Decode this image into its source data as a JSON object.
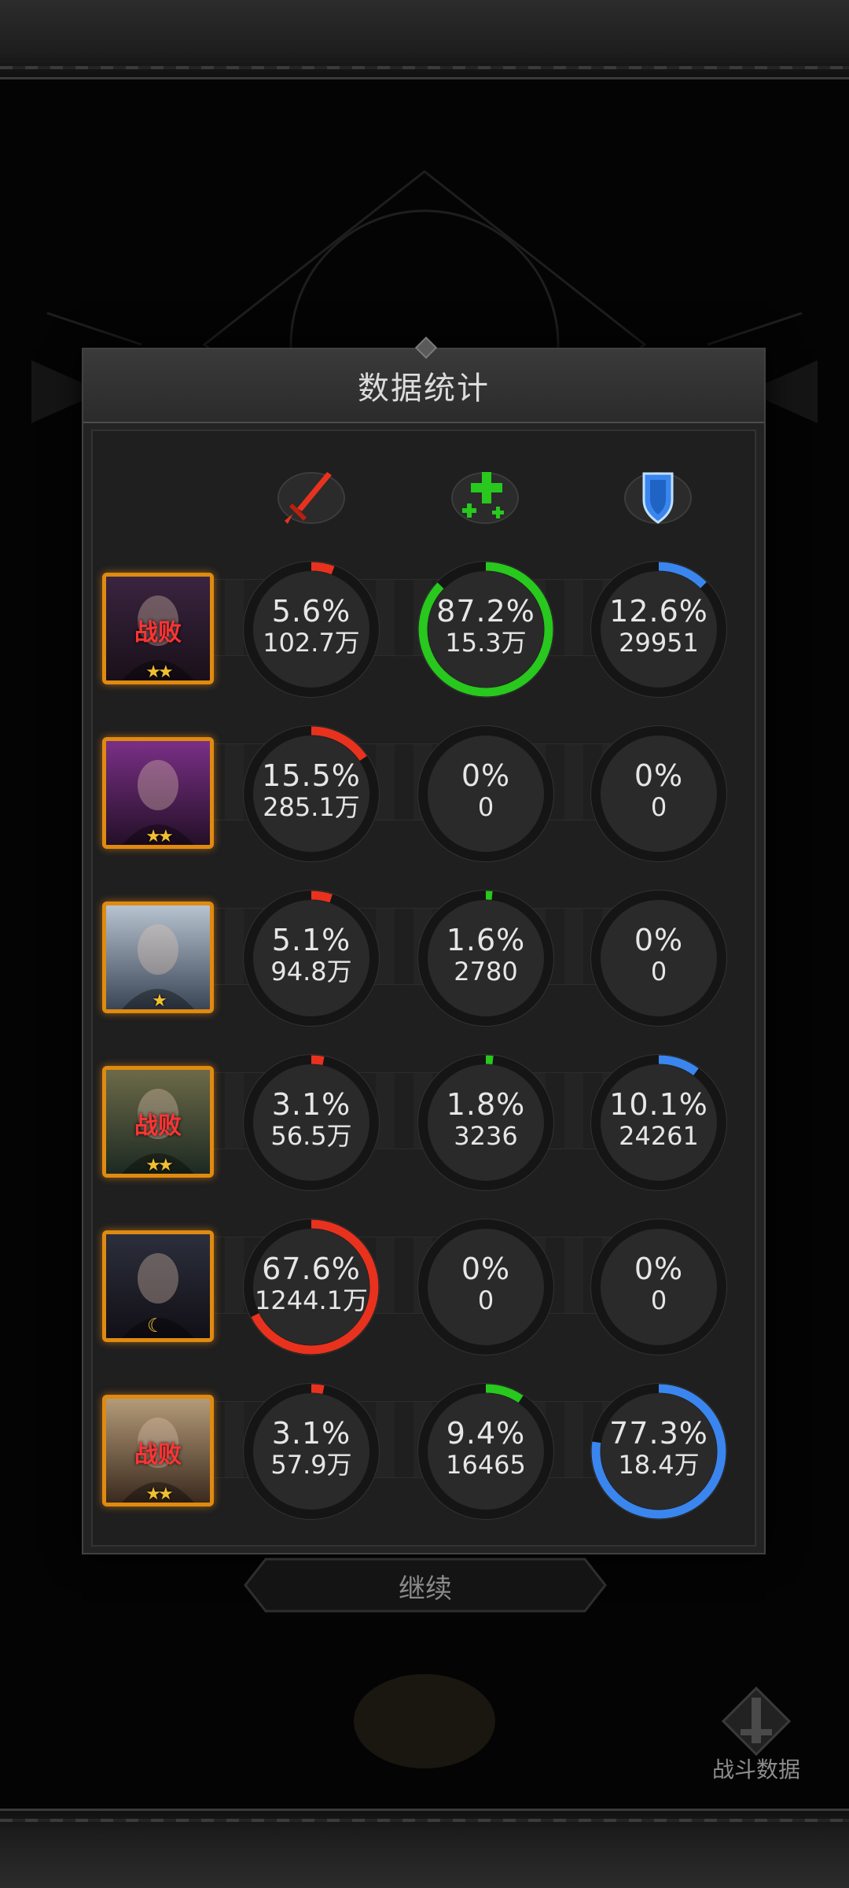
{
  "dialog": {
    "title": "数据统计"
  },
  "columns": [
    {
      "icon": "sword-icon",
      "color": "#e8321e"
    },
    {
      "icon": "heal-cross-icon",
      "color": "#28c81e"
    },
    {
      "icon": "shield-icon",
      "color": "#3a86ee"
    }
  ],
  "heroes": [
    {
      "defeated": true,
      "status": "战败",
      "stars": "★★",
      "stats": [
        {
          "pct": "5.6%",
          "value": "102.7万",
          "fraction": 0.056
        },
        {
          "pct": "87.2%",
          "value": "15.3万",
          "fraction": 0.872
        },
        {
          "pct": "12.6%",
          "value": "29951",
          "fraction": 0.126
        }
      ]
    },
    {
      "defeated": false,
      "status": "",
      "stars": "★★",
      "stats": [
        {
          "pct": "15.5%",
          "value": "285.1万",
          "fraction": 0.155
        },
        {
          "pct": "0%",
          "value": "0",
          "fraction": 0
        },
        {
          "pct": "0%",
          "value": "0",
          "fraction": 0
        }
      ]
    },
    {
      "defeated": false,
      "status": "",
      "stars": "★",
      "stats": [
        {
          "pct": "5.1%",
          "value": "94.8万",
          "fraction": 0.051
        },
        {
          "pct": "1.6%",
          "value": "2780",
          "fraction": 0.016
        },
        {
          "pct": "0%",
          "value": "0",
          "fraction": 0
        }
      ]
    },
    {
      "defeated": true,
      "status": "战败",
      "stars": "★★",
      "stats": [
        {
          "pct": "3.1%",
          "value": "56.5万",
          "fraction": 0.031
        },
        {
          "pct": "1.8%",
          "value": "3236",
          "fraction": 0.018
        },
        {
          "pct": "10.1%",
          "value": "24261",
          "fraction": 0.101
        }
      ]
    },
    {
      "defeated": false,
      "status": "",
      "stars": "",
      "moon": true,
      "stats": [
        {
          "pct": "67.6%",
          "value": "1244.1万",
          "fraction": 0.676
        },
        {
          "pct": "0%",
          "value": "0",
          "fraction": 0
        },
        {
          "pct": "0%",
          "value": "0",
          "fraction": 0
        }
      ]
    },
    {
      "defeated": true,
      "status": "战败",
      "stars": "★★",
      "stats": [
        {
          "pct": "3.1%",
          "value": "57.9万",
          "fraction": 0.031
        },
        {
          "pct": "9.4%",
          "value": "16465",
          "fraction": 0.094
        },
        {
          "pct": "77.3%",
          "value": "18.4万",
          "fraction": 0.773
        }
      ]
    }
  ],
  "buttons": {
    "continue": "继续",
    "battle_data": "战斗数据"
  }
}
